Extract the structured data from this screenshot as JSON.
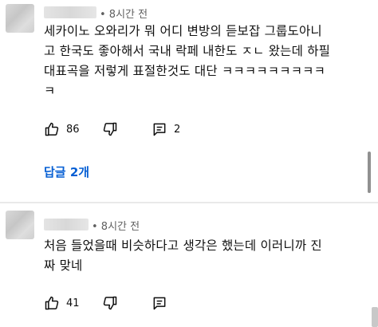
{
  "comments": [
    {
      "time": "• 8시간 전",
      "text": "세카이노 오와리가 뭐 어디 변방의 듣보잡 그룹도아니\n고 한국도 좋아해서 국내 락페 내한도 ㅈㄴ 왔는데 하필\n대표곡을 저렇게  표절한것도 대단 ㅋㅋㅋㅋㅋㅋㅋㅋㅋ\nㅋ",
      "likes": "86",
      "replies_count": "2",
      "replies_label": "답글 2개"
    },
    {
      "time": "• 8시간 전",
      "text": "처음 들었을때 비슷하다고 생각은 했는데 이러니까 진\n짜 맞네",
      "likes": "41"
    }
  ],
  "icons": {
    "like": "thumbs-up-icon",
    "dislike": "thumbs-down-icon",
    "reply": "comment-icon"
  },
  "colors": {
    "link": "#065fd4",
    "meta": "#606060"
  }
}
